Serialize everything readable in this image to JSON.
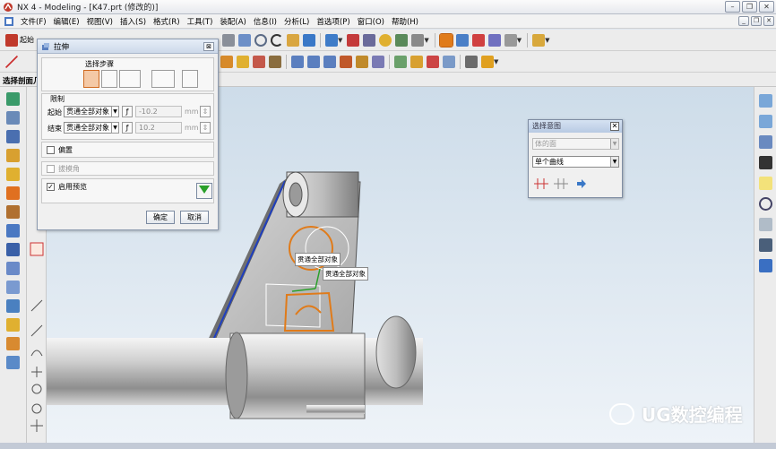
{
  "window": {
    "title": "NX 4 - Modeling - [K47.prt (修改的)]"
  },
  "menu": [
    "文件(F)",
    "编辑(E)",
    "视图(V)",
    "插入(S)",
    "格式(R)",
    "工具(T)",
    "装配(A)",
    "信息(I)",
    "分析(L)",
    "首选项(P)",
    "窗口(O)",
    "帮助(H)"
  ],
  "toolbar": {
    "start_label": "起始"
  },
  "selection_bar": {
    "label": "选择剖面几"
  },
  "extrude_dialog": {
    "title": "拉伸",
    "steps_label": "选择步骤",
    "limits_label": "限制",
    "start_label": "起始",
    "start_type": "贯通全部对象",
    "start_value": "-10.2",
    "end_label": "结束",
    "end_type": "贯通全部对象",
    "end_value": "10.2",
    "unit": "mm",
    "offset_label": "偏置",
    "draft_label": "拔模角",
    "preview_label": "启用预览",
    "preview_checked": true,
    "ok_label": "确定",
    "cancel_label": "取消"
  },
  "selection_dialog": {
    "title": "选择意图",
    "filter_value": "体的面",
    "curve_rule": "单个曲线"
  },
  "viewport_tips": [
    "贯通全部对象",
    "贯通全部对象"
  ],
  "watermark": "UG数控编程",
  "colors": {
    "accent_orange": "#e07b1a",
    "edge_blue": "#1f3fbf",
    "preview_green": "#2aa02a"
  }
}
